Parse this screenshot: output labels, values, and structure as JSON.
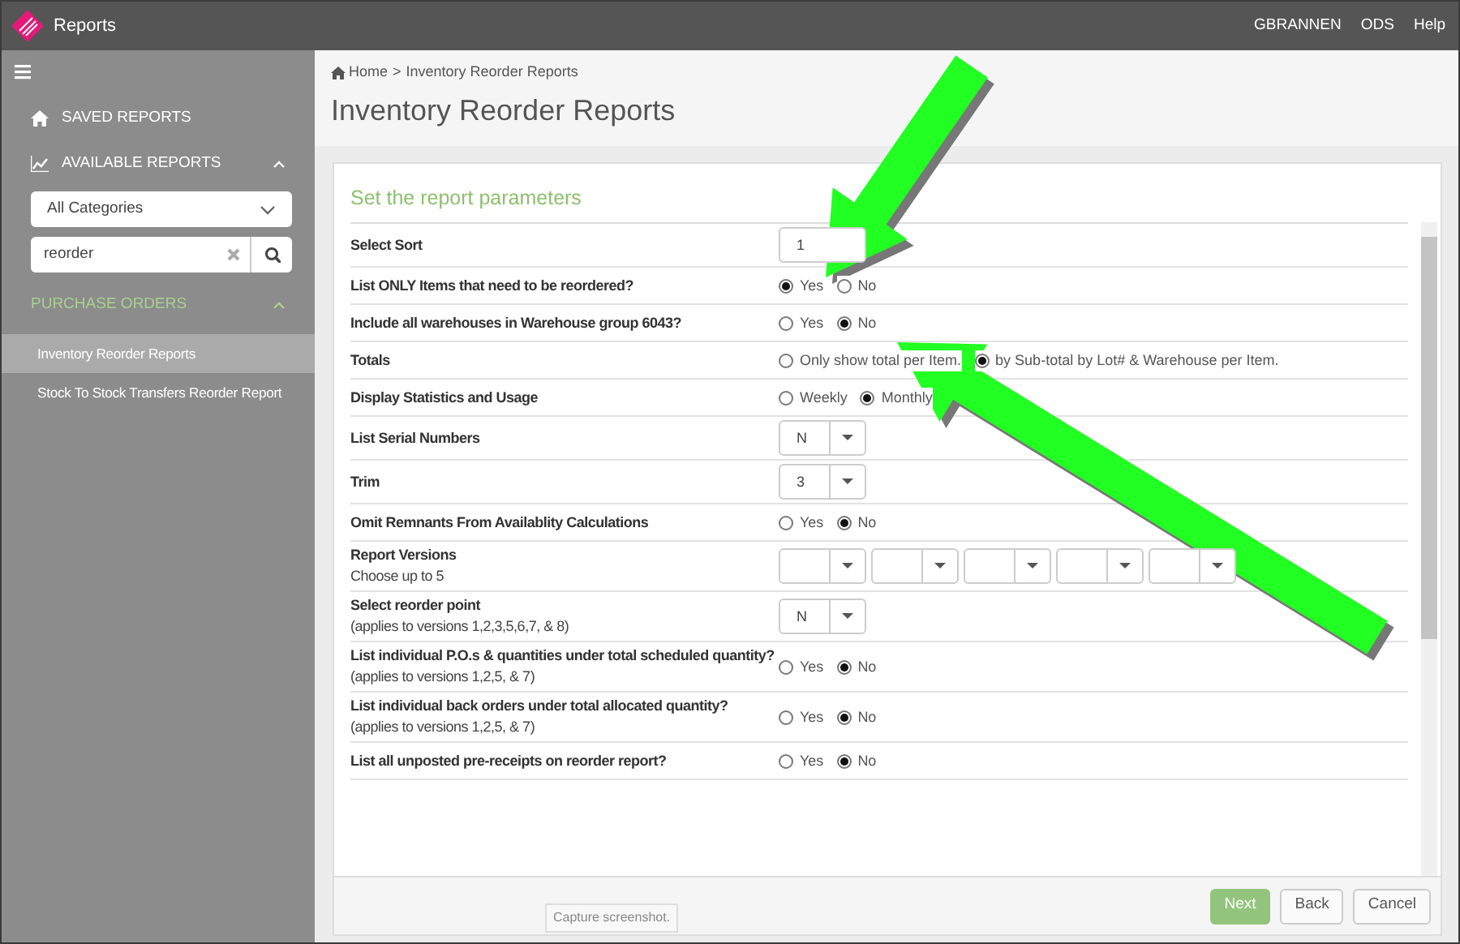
{
  "window": {
    "title": "Reports"
  },
  "user_menu": [
    "GBRANNEN",
    "ODS",
    "Help"
  ],
  "sidebar": {
    "saved_reports": {
      "label": "SAVED REPORTS"
    },
    "available_reports": {
      "label": "AVAILABLE REPORTS",
      "expanded": true
    },
    "category_filter": {
      "value": "All Categories"
    },
    "search": {
      "value": "reorder"
    },
    "groups": [
      {
        "label": "PURCHASE ORDERS",
        "expanded": true,
        "reports": [
          {
            "label": "Inventory Reorder Reports",
            "selected": true
          },
          {
            "label": "Stock To Stock Transfers Reorder Report",
            "selected": false
          }
        ]
      }
    ]
  },
  "breadcrumb": {
    "items": [
      "Home",
      "Inventory Reorder Reports"
    ],
    "separator": ">"
  },
  "page_title": "Inventory Reorder Reports",
  "form": {
    "title": "Set the report parameters",
    "rows": [
      {
        "kind": "input",
        "label": "Select Sort",
        "value": "1"
      },
      {
        "kind": "radio",
        "label": "List ONLY Items that need to be reordered?",
        "options": [
          {
            "label": "Yes",
            "selected": true
          },
          {
            "label": "No",
            "selected": false
          }
        ]
      },
      {
        "kind": "radio",
        "label": "Include all warehouses in Warehouse group 6043?",
        "options": [
          {
            "label": "Yes",
            "selected": false
          },
          {
            "label": "No",
            "selected": true
          }
        ]
      },
      {
        "kind": "radio",
        "label": "Totals",
        "options": [
          {
            "label": "Only show total per Item.",
            "selected": false
          },
          {
            "label": "by Sub-total by Lot# & Warehouse per Item.",
            "selected": true
          }
        ]
      },
      {
        "kind": "radio",
        "label": "Display Statistics and Usage",
        "options": [
          {
            "label": "Weekly",
            "selected": false
          },
          {
            "label": "Monthly",
            "selected": true
          }
        ]
      },
      {
        "kind": "select",
        "label": "List Serial Numbers",
        "value": "N"
      },
      {
        "kind": "select",
        "label": "Trim",
        "value": "3"
      },
      {
        "kind": "radio",
        "label": "Omit Remnants From Availablity Calculations",
        "options": [
          {
            "label": "Yes",
            "selected": false
          },
          {
            "label": "No",
            "selected": true
          }
        ]
      },
      {
        "kind": "multiselect",
        "label": "Report Versions",
        "note": "Choose up to 5",
        "selects": [
          {
            "kind": "dropdown"
          },
          {
            "kind": "dropdown"
          },
          {
            "kind": "dropdown"
          },
          {
            "kind": "dropdown"
          },
          {
            "kind": "dropdown"
          }
        ]
      },
      {
        "kind": "select",
        "label": "Select reorder point",
        "note": "(applies to versions 1,2,3,5,6,7, & 8)",
        "value": "N"
      },
      {
        "kind": "radio",
        "label": "List individual P.O.s & quantities under total scheduled quantity?",
        "note": "(applies to versions 1,2,5, & 7)",
        "options": [
          {
            "label": "Yes",
            "selected": false
          },
          {
            "label": "No",
            "selected": true
          }
        ]
      },
      {
        "kind": "radio",
        "label": "List individual back orders under total allocated quantity?",
        "note": "(applies to versions 1,2,5, & 7)",
        "options": [
          {
            "label": "Yes",
            "selected": false
          },
          {
            "label": "No",
            "selected": true
          }
        ]
      },
      {
        "kind": "radio",
        "label": "List all unposted pre-receipts on reorder report?",
        "options": [
          {
            "label": "Yes",
            "selected": false
          },
          {
            "label": "No",
            "selected": true
          }
        ]
      }
    ]
  },
  "buttons": [
    {
      "label": "Next",
      "kind": "primary"
    },
    {
      "label": "Back",
      "kind": "secondary"
    },
    {
      "label": "Cancel",
      "kind": "secondary"
    }
  ],
  "capture_button": {
    "label": "Capture screenshot."
  }
}
